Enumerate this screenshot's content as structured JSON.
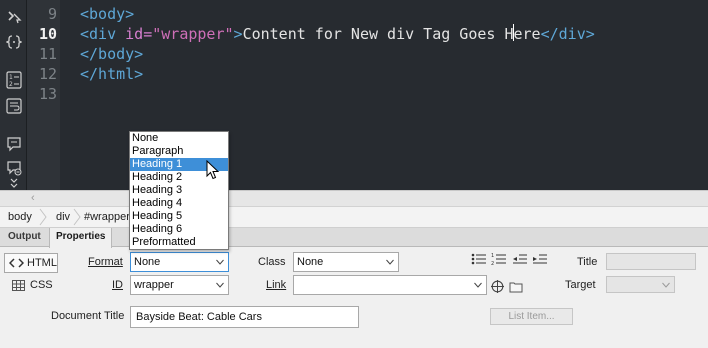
{
  "editor": {
    "line_numbers": [
      "9",
      "10",
      "11",
      "12",
      "13"
    ],
    "current_line": "10",
    "lines": [
      [
        {
          "c": "tg",
          "t": "<body>"
        }
      ],
      [
        {
          "c": "tg",
          "t": "<div "
        },
        {
          "c": "an",
          "t": "id="
        },
        {
          "c": "av",
          "t": "\"wrapper\""
        },
        {
          "c": "tg",
          "t": ">"
        },
        {
          "c": "tx",
          "t": "Content for New div Tag Goes Here"
        },
        {
          "c": "tg",
          "t": "</div>"
        }
      ],
      [
        {
          "c": "tg",
          "t": "</body>"
        }
      ],
      [
        {
          "c": "tg",
          "t": "</html>"
        }
      ],
      []
    ],
    "scroll_left_arrow": "‹"
  },
  "tag_selector": {
    "items": [
      "body",
      "div",
      "#wrapper"
    ]
  },
  "panel": {
    "tabs": [
      "Output",
      "Properties"
    ],
    "active_tab": "Properties",
    "html_button": "HTML",
    "css_button": "CSS",
    "format_label": "Format",
    "format_value": "None",
    "id_label": "ID",
    "id_value": "wrapper",
    "class_label": "Class",
    "class_value": "None",
    "link_label": "Link",
    "link_value": "",
    "title_label": "Title",
    "target_label": "Target",
    "document_title_label": "Document Title",
    "document_title_value": "Bayside Beat: Cable Cars",
    "list_item_button": "List Item..."
  },
  "format_menu": {
    "options": [
      "None",
      "Paragraph",
      "Heading 1",
      "Heading 2",
      "Heading 3",
      "Heading 4",
      "Heading 5",
      "Heading 6",
      "Preformatted"
    ],
    "highlighted": "Heading 1"
  },
  "colors": {
    "editor_bg": "#272b30",
    "tag": "#5ea7d6",
    "attr_name": "#d77fd0",
    "attr_value": "#cf6fb8",
    "text": "#e4e4e4",
    "selection": "#3e8fd8"
  }
}
